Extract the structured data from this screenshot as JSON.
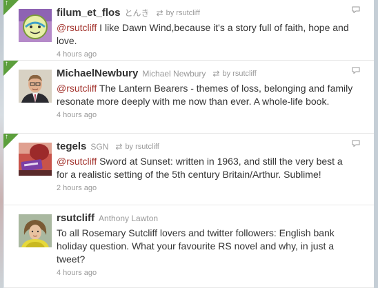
{
  "tweets": [
    {
      "screen_name": "filum_et_flos",
      "full_name": "とんき",
      "retweet_by": "by rsutcliff",
      "mention": "@rsutcliff",
      "text": " I like Dawn Wind,because it's a story full of faith, hope and love.",
      "timestamp": "4 hours ago",
      "avatar_icon": "cartoon-green-face-avatar",
      "is_retweet": true
    },
    {
      "screen_name": "MichaelNewbury",
      "full_name": "Michael Newbury",
      "retweet_by": "by rsutcliff",
      "mention": "@rsutcliff",
      "text": " The Lantern Bearers - themes of loss, belonging and family resonate more deeply with me now than ever. A whole-life book.",
      "timestamp": "4 hours ago",
      "avatar_icon": "man-in-suit-avatar",
      "is_retweet": true
    },
    {
      "screen_name": "tegels",
      "full_name": "SGN",
      "retweet_by": "by rsutcliff",
      "mention": "@rsutcliff",
      "text": " Sword at Sunset: written in 1963, and still the very best a for a realistic setting of the 5th century Britain/Arthur. Sublime!",
      "timestamp": "2 hours ago",
      "avatar_icon": "red-purple-sign-avatar",
      "is_retweet": true
    },
    {
      "screen_name": "rsutcliff",
      "full_name": "Anthony Lawton",
      "retweet_by": "",
      "mention": "",
      "text": "To all Rosemary Sutcliff lovers and twitter followers: English bank holiday question. What your favourite RS novel and why, in just a tweet?",
      "timestamp": "4 hours ago",
      "avatar_icon": "woman-portrait-avatar",
      "is_retweet": false
    }
  ],
  "colors": {
    "retweet_badge": "#5c9f3c",
    "mention": "#a3342e",
    "screen_name": "#333333",
    "meta": "#999999"
  }
}
